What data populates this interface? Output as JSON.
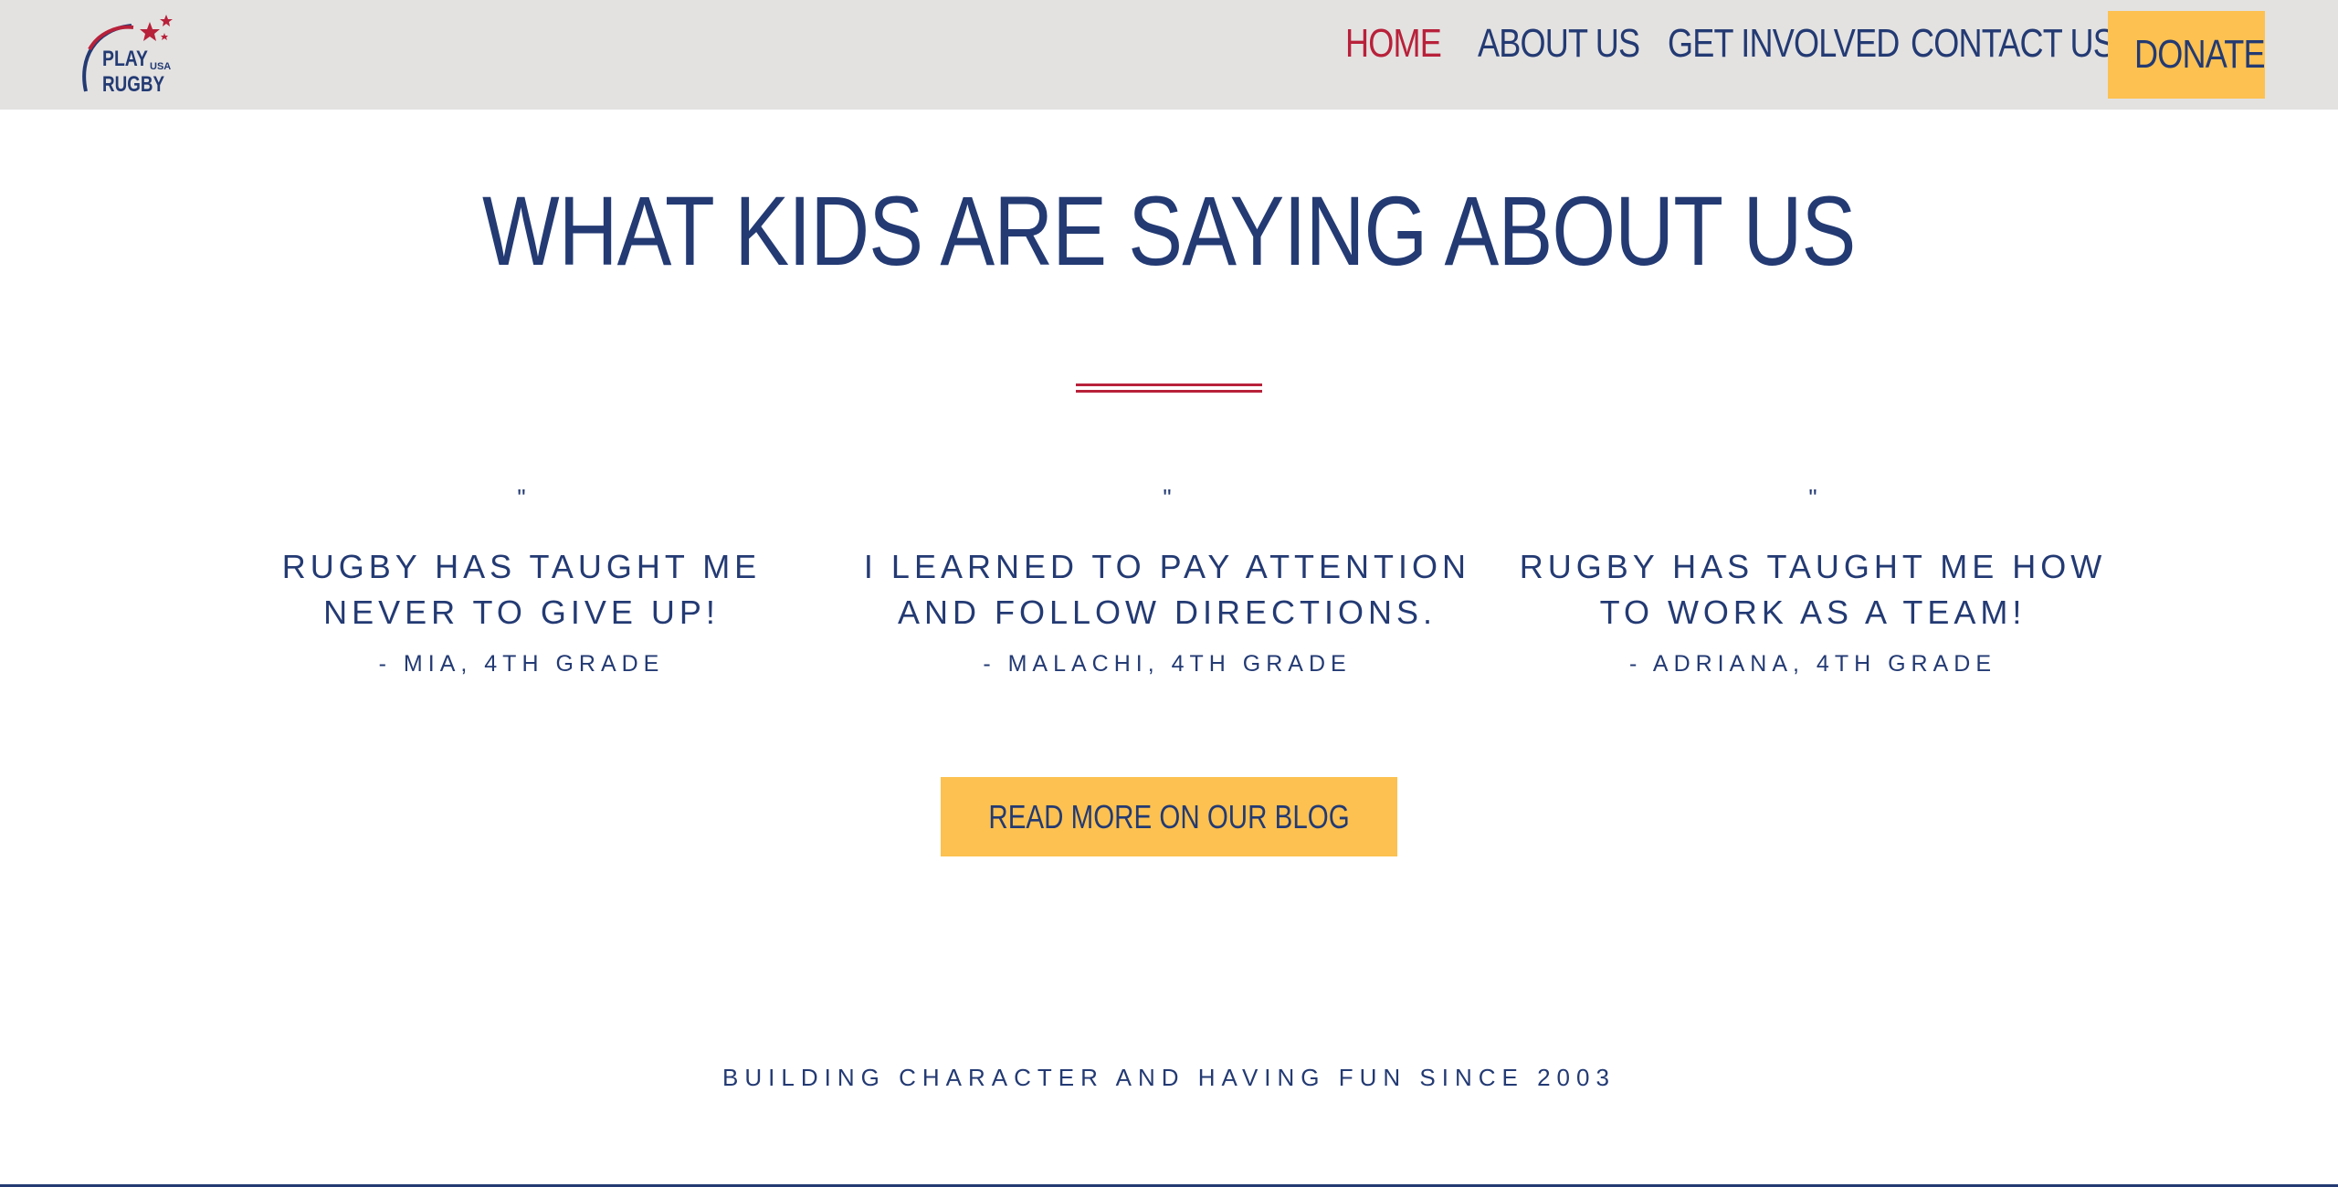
{
  "header": {
    "logo": {
      "line1": "PLAY",
      "line2": "RUGBY",
      "badge": "USA"
    },
    "nav": [
      {
        "label": "HOME",
        "active": true
      },
      {
        "label": "ABOUT US",
        "active": false
      },
      {
        "label": "GET INVOLVED",
        "active": false
      },
      {
        "label": "CONTACT US",
        "active": false
      }
    ],
    "donate_label": "DONATE"
  },
  "main": {
    "title": "WHAT KIDS ARE SAYING ABOUT US",
    "testimonials": [
      {
        "quote_mark": "\"",
        "text": "RUGBY HAS TAUGHT ME NEVER TO GIVE UP!",
        "author": "- MIA, 4TH GRADE"
      },
      {
        "quote_mark": "\"",
        "text": "I LEARNED TO PAY ATTENTION AND FOLLOW DIRECTIONS.",
        "author": "- MALACHI, 4TH GRADE"
      },
      {
        "quote_mark": "\"",
        "text": "RUGBY HAS TAUGHT ME HOW TO WORK AS A TEAM!",
        "author": "- ADRIANA, 4TH GRADE"
      }
    ],
    "cta_label": "READ MORE ON OUR BLOG",
    "tagline": "BUILDING CHARACTER AND HAVING FUN SINCE 2003"
  },
  "colors": {
    "header_bg": "#e3e2e1",
    "navy": "#233a73",
    "red": "#b8213a",
    "gold": "#fcc150"
  }
}
